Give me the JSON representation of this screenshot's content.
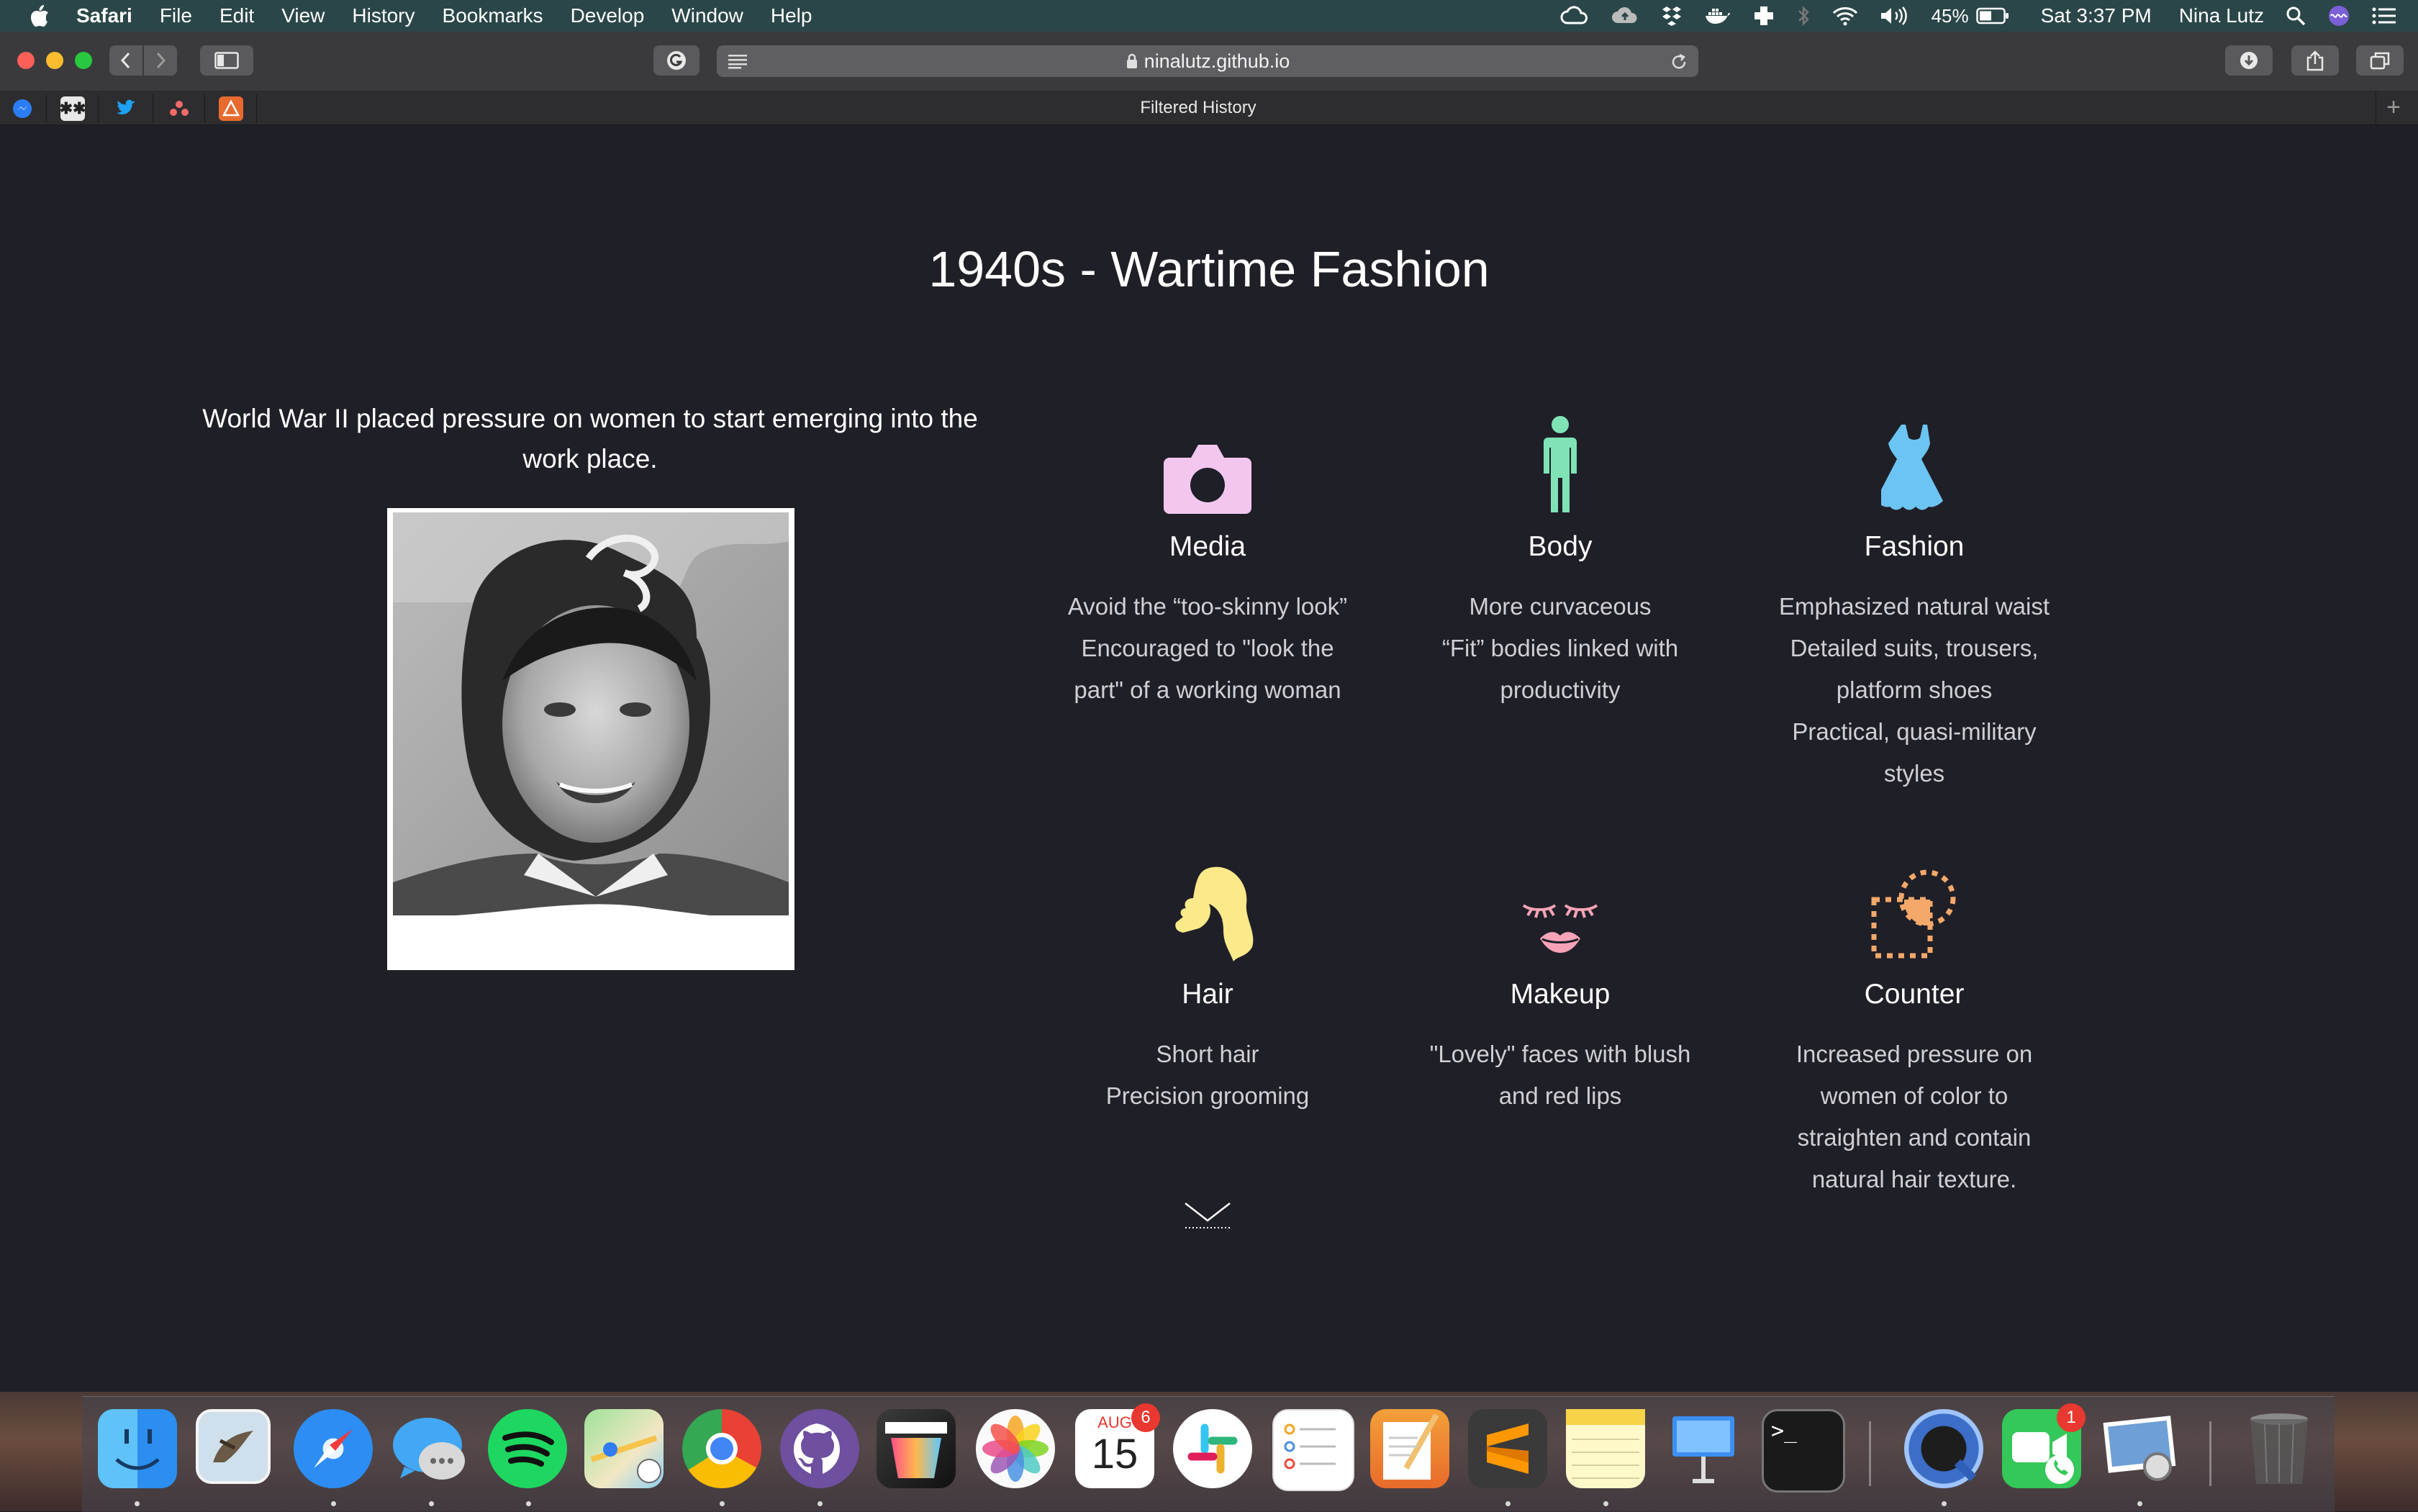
{
  "menubar": {
    "app": "Safari",
    "items": [
      "File",
      "Edit",
      "View",
      "History",
      "Bookmarks",
      "Develop",
      "Window",
      "Help"
    ],
    "battery": "45%",
    "clock": "Sat 3:37 PM",
    "user": "Nina Lutz"
  },
  "browser": {
    "url": "ninalutz.github.io",
    "tab_title": "Filtered History"
  },
  "page": {
    "title": "1940s - Wartime Fashion",
    "intro": "World War II placed pressure on women to start emerging into the work place.",
    "cards": [
      {
        "label": "Media",
        "icon": "camera-icon",
        "color": "#f3c6f0",
        "lines": [
          "Avoid the “too-skinny look”",
          "Encouraged to \"look the",
          "part\" of a working woman"
        ]
      },
      {
        "label": "Body",
        "icon": "person-icon",
        "color": "#7fe3b6",
        "lines": [
          "More curvaceous",
          "“Fit” bodies linked with",
          "productivity"
        ]
      },
      {
        "label": "Fashion",
        "icon": "dress-icon",
        "color": "#6cc4f2",
        "lines": [
          "Emphasized natural waist",
          "Detailed suits, trousers,",
          "platform shoes",
          "Practical, quasi-military",
          "styles"
        ]
      },
      {
        "label": "Hair",
        "icon": "hair-icon",
        "color": "#fbe98a",
        "lines": [
          "Short hair",
          "Precision grooming"
        ]
      },
      {
        "label": "Makeup",
        "icon": "lips-icon",
        "color": "#f7a3b7",
        "lines": [
          "\"Lovely\" faces with blush",
          "and red lips"
        ]
      },
      {
        "label": "Counter",
        "icon": "counter-icon",
        "color": "#f4a86a",
        "lines": [
          "Increased pressure on",
          "women of color to",
          "straighten and contain",
          "natural hair texture."
        ]
      }
    ]
  },
  "dock": {
    "calendar_month": "AUG",
    "calendar_day": "15",
    "calendar_badge": "6",
    "facetime_badge": "1",
    "terminal_prompt": ">_"
  }
}
